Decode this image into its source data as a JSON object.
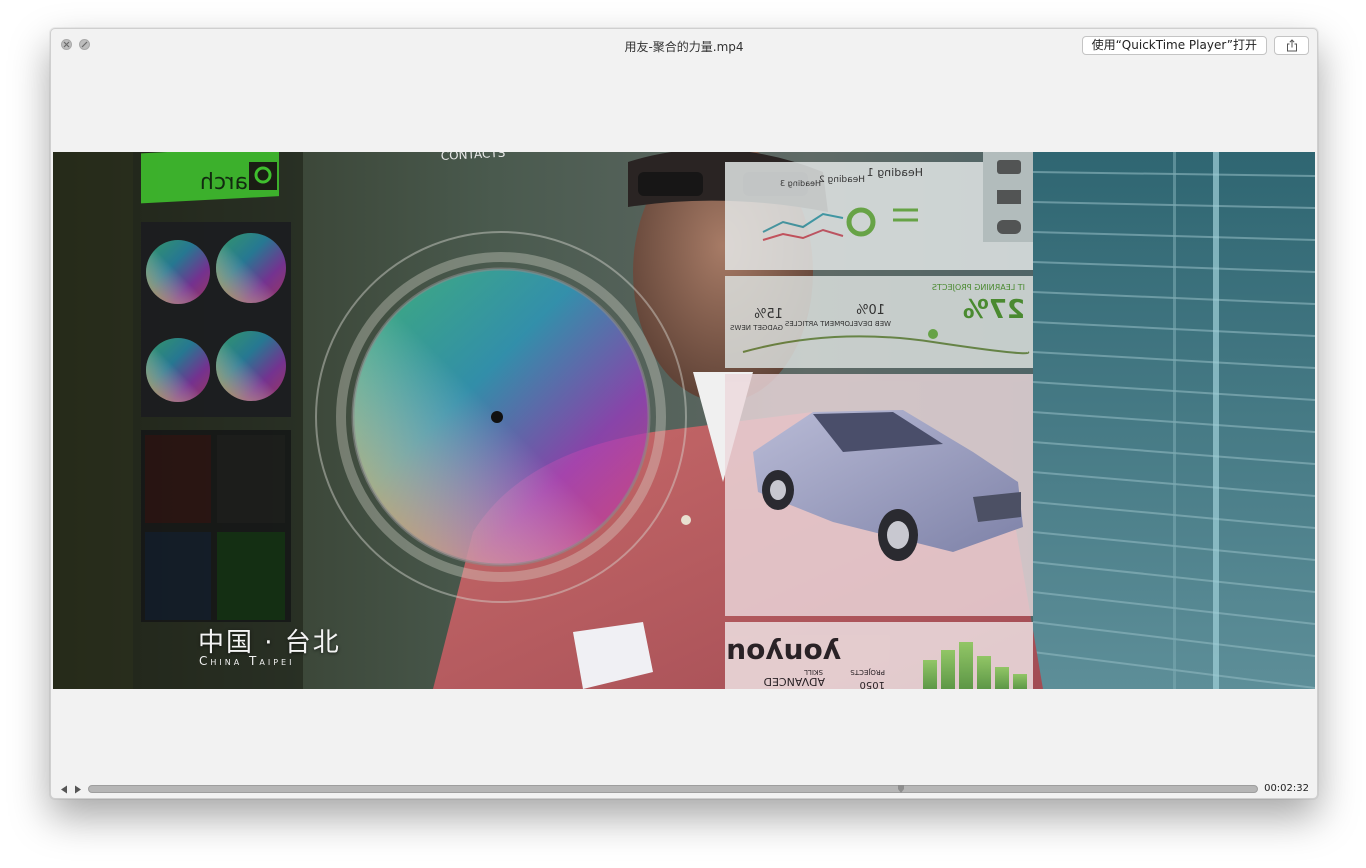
{
  "window": {
    "title": "用友-聚合的力量.mp4"
  },
  "toolbar": {
    "open_with_label": "使用“QuickTime Player”打开",
    "share_icon": "share-icon",
    "close_icon": "close-icon",
    "minimize_icon": "minimize-icon"
  },
  "video": {
    "caption_cn": "中国 · 台北",
    "caption_en": "China Taipei",
    "overlay": {
      "search_label": "search",
      "contacts_label": "CONTACTS",
      "heading1": "Heading 1",
      "heading2": "Heading 2",
      "heading3": "Heading 3",
      "stat_27": "27%",
      "stat_27_label": "IT LEARNING PROJECTS",
      "stat_10": "10%",
      "stat_10_label": "WEB DEVELOPMENT ARTICLES",
      "stat_15": "15%",
      "stat_15_label": "GADGET NEWS",
      "brand": "yonyou",
      "advanced": "ADVANCED",
      "skill": "SKILL",
      "projects": "PROJECTS",
      "projects_value": "1050"
    }
  },
  "controls": {
    "back_icon": "step-back-icon",
    "play_icon": "play-icon",
    "timecode": "00:02:32",
    "progress": 0.695
  }
}
